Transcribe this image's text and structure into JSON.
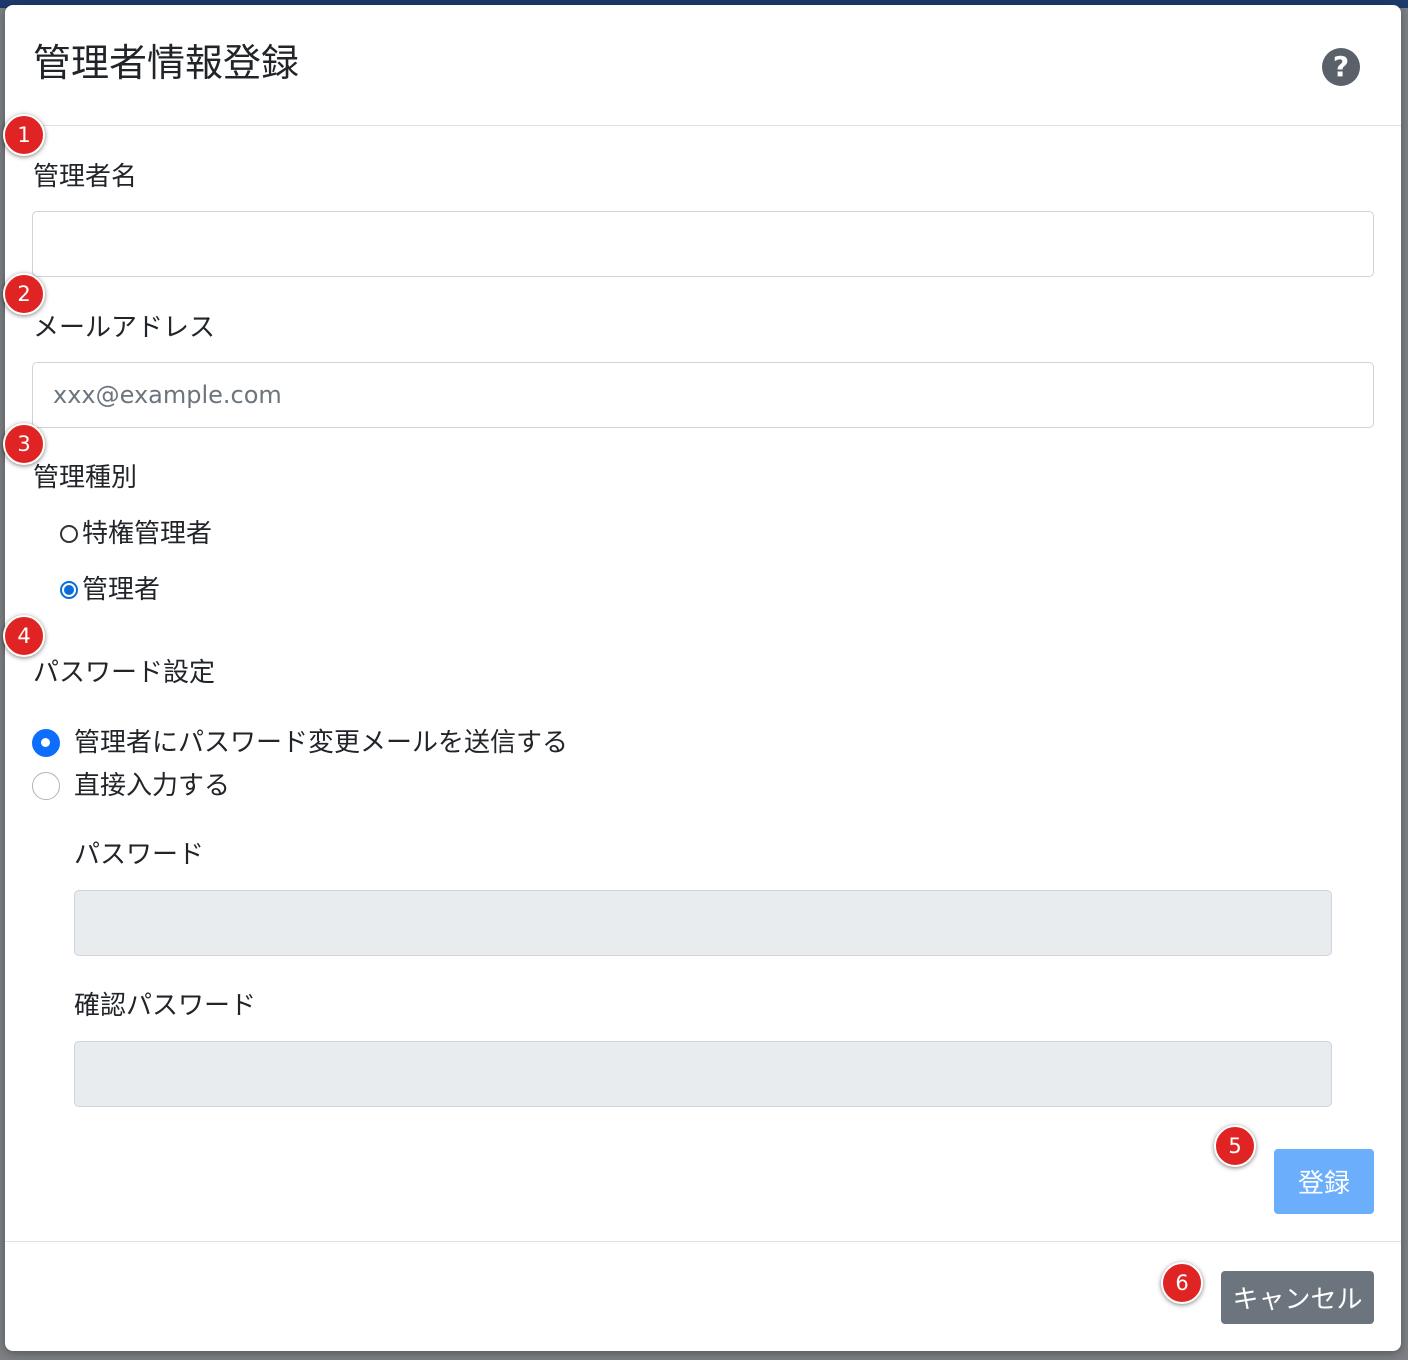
{
  "modal": {
    "title": "管理者情報登録",
    "help_icon_glyph": "?"
  },
  "markers": [
    "1",
    "2",
    "3",
    "4",
    "5",
    "6"
  ],
  "fields": {
    "admin_name": {
      "label": "管理者名",
      "value": ""
    },
    "email": {
      "label": "メールアドレス",
      "placeholder": "xxx@example.com",
      "value": ""
    },
    "admin_type": {
      "label": "管理種別",
      "options": [
        {
          "label": "特権管理者",
          "checked": false
        },
        {
          "label": "管理者",
          "checked": true
        }
      ]
    },
    "password_setting": {
      "label": "パスワード設定",
      "options": [
        {
          "label": "管理者にパスワード変更メールを送信する",
          "checked": true
        },
        {
          "label": "直接入力する",
          "checked": false
        }
      ]
    },
    "password": {
      "label": "パスワード",
      "value": ""
    },
    "confirm_password": {
      "label": "確認パスワード",
      "value": ""
    }
  },
  "buttons": {
    "register": "登録",
    "cancel": "キャンセル"
  },
  "icons": {
    "help": "question-circle-icon",
    "radio_checked": "radio-checked-icon",
    "radio_unchecked": "radio-unchecked-icon"
  },
  "colors": {
    "primary": "#6aaefc",
    "secondary": "#6c757d",
    "marker": "#e02424",
    "radio_accent": "#0d6efd"
  }
}
